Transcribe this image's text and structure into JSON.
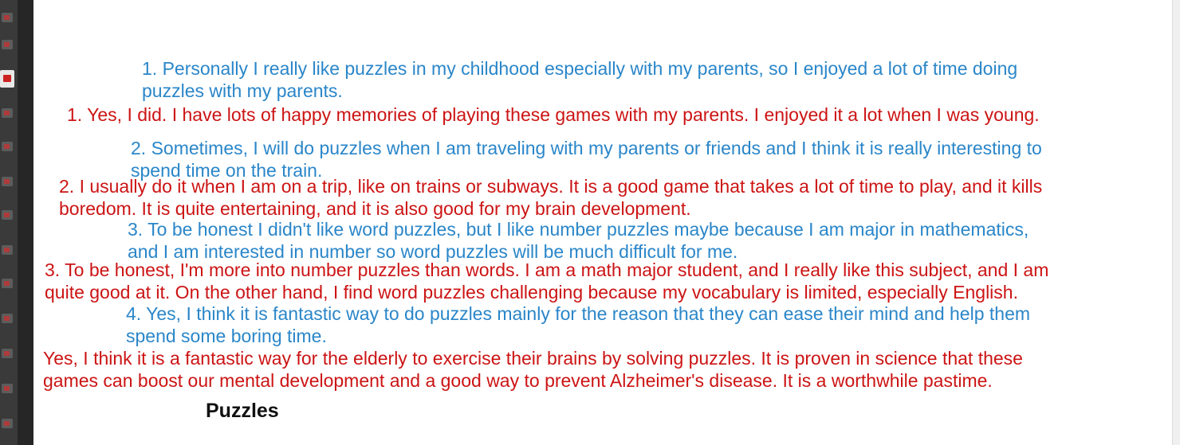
{
  "document": {
    "title": "Puzzles",
    "answers": [
      {
        "id": "b1",
        "style": "blue",
        "text": "1. Personally I really like puzzles in my childhood especially with my parents, so I enjoyed a lot of time doing\npuzzles with my parents."
      },
      {
        "id": "r1",
        "style": "red",
        "text": "1. Yes, I did. I have lots of happy memories of playing these games with my parents. I enjoyed it a lot when I was young."
      },
      {
        "id": "b2",
        "style": "blue",
        "text": "2. Sometimes, I will do puzzles when I am traveling with my parents or friends and I think it is really interesting to\nspend time on the train."
      },
      {
        "id": "r2",
        "style": "red",
        "text": "2. I usually do it when I am on a trip, like on trains or subways. It is a good game that takes a lot of time to play, and it kills\nboredom. It is quite entertaining, and it is also good for my brain development."
      },
      {
        "id": "b3",
        "style": "blue",
        "text": "3. To be honest I didn't like word puzzles, but I like number puzzles maybe because I am major in mathematics,\nand I am interested in number so word puzzles will be much difficult for me."
      },
      {
        "id": "r3",
        "style": "red",
        "text": "3. To be honest, I'm more into number puzzles than words. I am a math major student, and I really like this subject, and I am\nquite good at it. On the other hand, I find word puzzles challenging because my vocabulary is limited, especially English."
      },
      {
        "id": "b4",
        "style": "blue",
        "text": "4. Yes, I think it is fantastic way to do puzzles mainly for the reason that they can ease their mind and help them\nspend some boring time."
      },
      {
        "id": "r4",
        "style": "red",
        "text": "Yes, I think it is a fantastic way for the elderly to exercise their brains by solving puzzles. It is proven in science that these\ngames can boost our mental development and a good way to prevent Alzheimer's disease. It is a worthwhile pastime."
      }
    ]
  },
  "colors": {
    "blue_text": "#2a86c9",
    "red_text": "#cc1414"
  }
}
